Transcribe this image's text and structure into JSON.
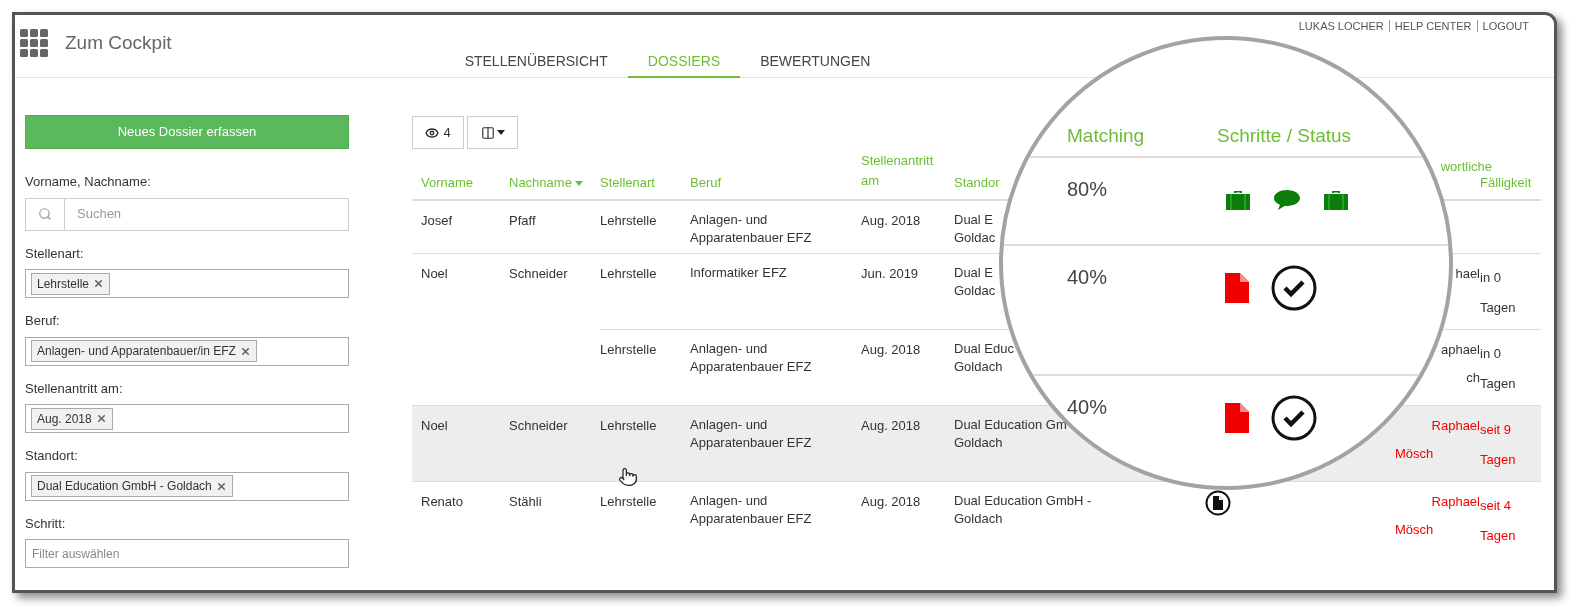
{
  "header": {
    "title": "Zum Cockpit",
    "tabs": [
      {
        "label": "STELLENÜBERSICHT",
        "selected": false
      },
      {
        "label": "DOSSIERS",
        "selected": true
      },
      {
        "label": "BEWERTUNGEN",
        "selected": false
      }
    ],
    "user_links": [
      "LUKAS LOCHER",
      "HELP CENTER",
      "LOGOUT"
    ]
  },
  "sidebar": {
    "new_button": "Neues Dossier erfassen",
    "filters": [
      {
        "kind": "search",
        "label": "Vorname, Nachname:",
        "placeholder": "Suchen"
      },
      {
        "kind": "tags",
        "label": "Stellenart:",
        "tags": [
          "Lehrstelle"
        ]
      },
      {
        "kind": "tags",
        "label": "Beruf:",
        "tags": [
          "Anlagen- und Apparatenbauer/in EFZ"
        ]
      },
      {
        "kind": "tags",
        "label": "Stellenantritt am:",
        "tags": [
          "Aug. 2018"
        ]
      },
      {
        "kind": "tags",
        "label": "Standort:",
        "tags": [
          "Dual Education GmbH - Goldach"
        ]
      },
      {
        "kind": "select",
        "label": "Schritt:",
        "placeholder": "Filter auswählen"
      }
    ]
  },
  "toolbar": {
    "view_count": "4"
  },
  "table": {
    "columns": [
      {
        "label": "Vorname",
        "sorted": false
      },
      {
        "label": "Nachname",
        "sorted": true
      },
      {
        "label": "Stellenart",
        "sorted": false
      },
      {
        "label": "Beruf",
        "sorted": false
      },
      {
        "label": "Stellenantritt am",
        "sorted": false
      },
      {
        "label": "Standor",
        "sorted": false
      },
      {
        "label": "wortliche",
        "sorted": false
      },
      {
        "label": "Fälligkeit",
        "sorted": false
      }
    ],
    "rows": [
      {
        "vorname": "Josef",
        "nachname": "Pfaff",
        "stellenart": "Lehrstelle",
        "beruf": [
          "Anlagen- und",
          "Apparatenbauer EFZ"
        ],
        "antritt": "Aug. 2018",
        "standort": [
          "Dual E",
          "Goldac"
        ],
        "grouped": false,
        "highlighted": false
      },
      {
        "vorname": "Noel",
        "nachname": "Schneider",
        "stellenart": "Lehrstelle",
        "beruf": [
          "Informatiker EFZ"
        ],
        "antritt": "Jun. 2019",
        "standort": [
          "Dual E",
          "Goldac"
        ],
        "verantwortlich": {
          "lines": [
            "hael"
          ],
          "overdue": false
        },
        "faelligkeit": {
          "lines": [
            "in 0",
            "Tagen"
          ],
          "overdue": false
        },
        "grouped": false,
        "highlighted": false
      },
      {
        "stellenart": "Lehrstelle",
        "beruf": [
          "Anlagen- und",
          "Apparatenbauer EFZ"
        ],
        "antritt": "Aug. 2018",
        "standort": [
          "Dual Educ",
          "Goldach"
        ],
        "verantwortlich": {
          "lines": [
            "aphael",
            "ch"
          ],
          "overdue": false
        },
        "faelligkeit": {
          "lines": [
            "in 0",
            "Tagen"
          ],
          "overdue": false
        },
        "grouped": true,
        "highlighted": false
      },
      {
        "vorname": "Noel",
        "nachname": "Schneider",
        "stellenart": "Lehrstelle",
        "beruf": [
          "Anlagen- und",
          "Apparatenbauer EFZ"
        ],
        "antritt": "Aug. 2018",
        "standort": [
          "Dual Education Gm",
          "Goldach"
        ],
        "verantwortlich": {
          "lines": [
            "Raphael",
            "Mösch"
          ],
          "overdue": true
        },
        "faelligkeit": {
          "lines": [
            "seit 9",
            "Tagen"
          ],
          "overdue": true
        },
        "grouped": false,
        "highlighted": true
      },
      {
        "vorname": "Renato",
        "nachname": "Stähli",
        "stellenart": "Lehrstelle",
        "beruf": [
          "Anlagen- und",
          "Apparatenbauer EFZ"
        ],
        "antritt": "Aug. 2018",
        "standort": [
          "Dual Education GmbH -",
          "Goldach"
        ],
        "status": {
          "kind": "file-circle"
        },
        "verantwortlich": {
          "lines": [
            "Raphael",
            "Mösch"
          ],
          "overdue": true
        },
        "faelligkeit": {
          "lines": [
            "seit 4",
            "Tagen"
          ],
          "overdue": true
        },
        "grouped": false,
        "highlighted": false
      }
    ]
  },
  "magnifier": {
    "columns": [
      "Matching",
      "Schritte / Status"
    ],
    "rows": [
      {
        "matching": "80%",
        "steps": [
          {
            "kind": "briefcase"
          },
          {
            "kind": "speech"
          },
          {
            "kind": "briefcase"
          }
        ]
      },
      {
        "matching": "40%",
        "steps": [
          {
            "kind": "file"
          },
          {
            "kind": "check"
          }
        ]
      },
      {
        "matching": "40%",
        "steps": [
          {
            "kind": "file"
          },
          {
            "kind": "check"
          }
        ]
      }
    ]
  }
}
